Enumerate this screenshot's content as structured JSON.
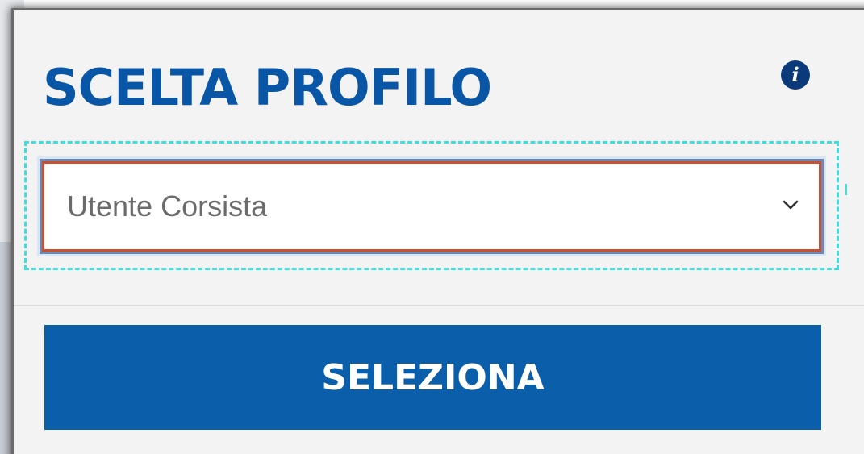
{
  "dialog": {
    "title": "SCELTA PROFILO",
    "info_icon": "info-circle-icon"
  },
  "profile_select": {
    "selected_value": "Utente Corsista",
    "chevron_icon": "chevron-down-icon"
  },
  "actions": {
    "select_label": "SELEZIONA"
  },
  "colors": {
    "title": "#0a56a6",
    "button_bg": "#0b5eaa",
    "select_border": "#c9502c",
    "focus_ring": "#3fdede",
    "panel_bg": "#f3f3f3"
  }
}
